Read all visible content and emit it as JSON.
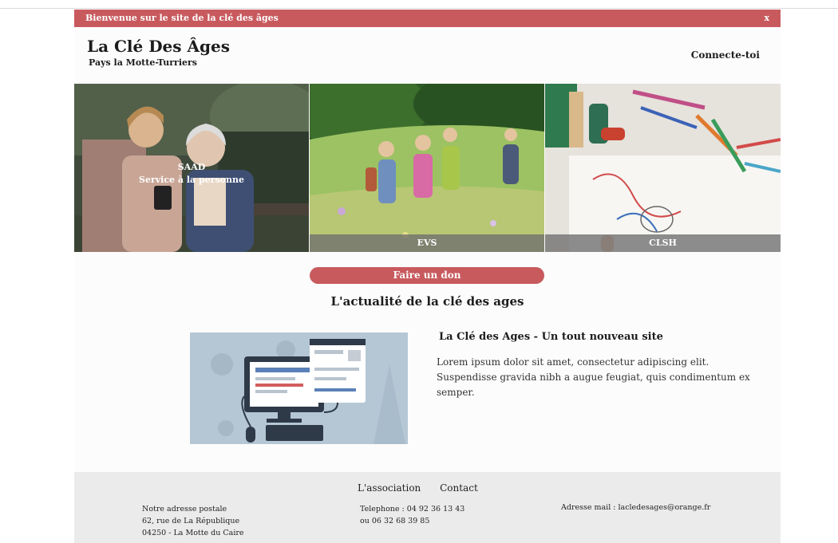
{
  "banner": {
    "message": "Bienvenue sur le site de la clé des âges",
    "close_label": "x"
  },
  "header": {
    "title": "La Clé Des Âges",
    "subtitle": "Pays la Motte-Turriers",
    "login_label": "Connecte-toi"
  },
  "services": [
    {
      "title": "SAAD",
      "subtitle": "Service à la personne"
    },
    {
      "title": "EVS"
    },
    {
      "title": "CLSH"
    }
  ],
  "donate_label": "Faire un don",
  "news": {
    "heading": "L'actualité de la clé des ages",
    "article": {
      "title": "La Clé des Ages - Un tout nouveau site",
      "text": "Lorem ipsum dolor sit amet, consectetur adipiscing elit. Suspendisse gravida nibh a augue feugiat, quis condimentum ex semper."
    }
  },
  "footer": {
    "nav": [
      "L'association",
      "Contact"
    ],
    "address": [
      "Notre adresse postale",
      "62, rue de La République",
      "04250 - La Motte du Caire"
    ],
    "phone": [
      "Telephone : 04 92 36 13 43",
      "ou 06 32 68 39 85"
    ],
    "email": "Adresse mail : lacledesages@orange.fr"
  },
  "colors": {
    "accent": "#c85a5e",
    "footer_bg": "#ebebeb"
  },
  "icons": [
    "close-icon"
  ]
}
